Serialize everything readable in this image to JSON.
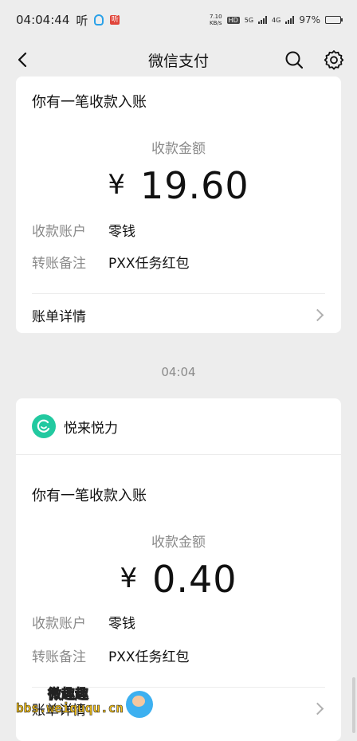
{
  "status_bar": {
    "time": "04:04:44",
    "app_label": "听",
    "red_app_label": "听",
    "net_speed": "7.10\nKB/s",
    "net_speed_top": "7.10",
    "net_speed_bottom": "KB/s",
    "hd": "HD",
    "five_g": "5G",
    "four_g": "4G",
    "battery": "97%",
    "battery_level": 0.97
  },
  "nav": {
    "title": "微信支付",
    "back_icon": "back-arrow-icon",
    "search_icon": "search-icon",
    "settings_icon": "gear-icon"
  },
  "card1": {
    "heading": "你有一笔收款入账",
    "amount_label": "收款金额",
    "currency": "¥",
    "amount": "19.60",
    "account_key": "收款账户",
    "account_value": "零钱",
    "note_key": "转账备注",
    "note_value": "PXX任务红包",
    "detail_link": "账单详情"
  },
  "timestamp": "04:04",
  "card2": {
    "merchant": "悦来悦力",
    "heading": "你有一笔收款入账",
    "amount_label": "收款金额",
    "currency": "¥",
    "amount": "0.40",
    "account_key": "收款账户",
    "account_value": "零钱",
    "note_key": "转账备注",
    "note_value": "PXX任务红包",
    "detail_link": "账单详情"
  },
  "watermark": {
    "title": "微趣趣",
    "url": "bbs.weiququ.cn"
  },
  "colors": {
    "background": "#ededed",
    "card": "#ffffff",
    "muted_text": "#8a8a8a",
    "merchant_logo": "#22c9a0"
  }
}
